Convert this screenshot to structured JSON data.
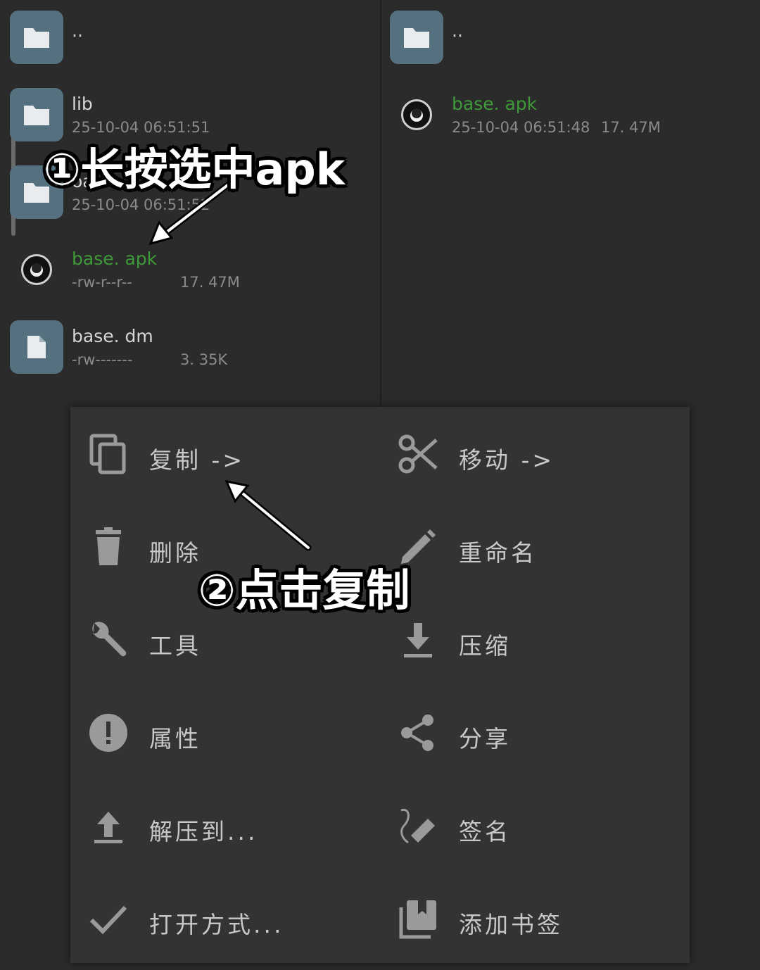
{
  "left_pane": {
    "parent_dir": "..",
    "files": [
      {
        "name": "lib",
        "meta": "25-10-04 06:51:51",
        "size": "",
        "icon": "folder-icon"
      },
      {
        "name": "oat",
        "meta": "25-10-04 06:51:52",
        "size": "",
        "icon": "folder-icon"
      },
      {
        "name": "base. apk",
        "meta": "-rw-r--r--",
        "size": "17. 47M",
        "icon": "apk-app-icon"
      },
      {
        "name": "base. dm",
        "meta": "-rw-------",
        "size": "3. 35K",
        "icon": "file-icon"
      }
    ]
  },
  "right_pane": {
    "parent_dir": "..",
    "files": [
      {
        "name": "base. apk",
        "meta": "25-10-04 06:51:48",
        "size": "17. 47M",
        "icon": "apk-app-icon"
      }
    ]
  },
  "menu": {
    "items": [
      {
        "label": "复制 ->",
        "icon": "copy-icon"
      },
      {
        "label": "移动 ->",
        "icon": "scissors-icon"
      },
      {
        "label": "删除",
        "icon": "trash-icon"
      },
      {
        "label": "重命名",
        "icon": "pencil-icon"
      },
      {
        "label": "工具",
        "icon": "wrench-icon"
      },
      {
        "label": "压缩",
        "icon": "download-icon"
      },
      {
        "label": "属性",
        "icon": "exclamation-icon"
      },
      {
        "label": "分享",
        "icon": "share-icon"
      },
      {
        "label": "解压到...",
        "icon": "upload-icon"
      },
      {
        "label": "签名",
        "icon": "signature-icon"
      },
      {
        "label": "打开方式...",
        "icon": "check-icon"
      },
      {
        "label": "添加书签",
        "icon": "bookmark-icon"
      }
    ]
  },
  "annotations": {
    "step1": "①长按选中apk",
    "step2": "②点击复制"
  },
  "colors": {
    "background": "#2b2b2b",
    "menu_background": "#333333",
    "folder_tile": "#55707f",
    "apk_name": "#3f9a3a",
    "icon_gray": "#9a9a9a"
  }
}
